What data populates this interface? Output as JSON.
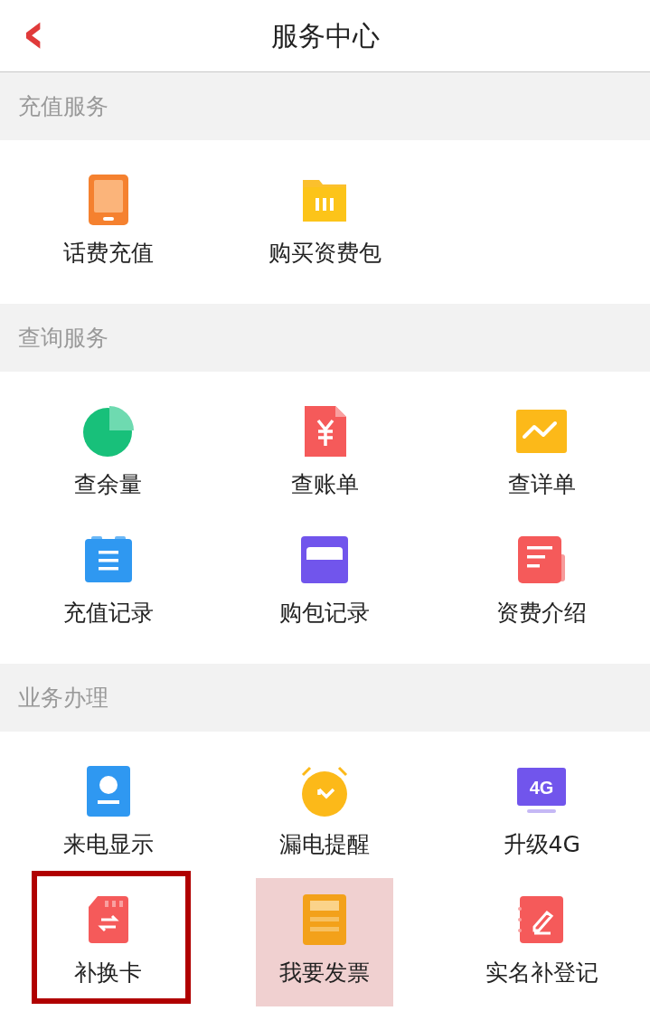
{
  "header": {
    "title": "服务中心",
    "back": "‹"
  },
  "sections": [
    {
      "title": "充值服务",
      "items": [
        {
          "label": "话费充值",
          "kind": "phone",
          "selected": false,
          "outlined": false
        },
        {
          "label": "购买资费包",
          "kind": "folder",
          "selected": false,
          "outlined": false
        }
      ]
    },
    {
      "title": "查询服务",
      "items": [
        {
          "label": "查余量",
          "kind": "pie",
          "selected": false,
          "outlined": false
        },
        {
          "label": "查账单",
          "kind": "yen",
          "selected": false,
          "outlined": false
        },
        {
          "label": "查详单",
          "kind": "trend",
          "selected": false,
          "outlined": false
        },
        {
          "label": "充值记录",
          "kind": "clipboard",
          "selected": false,
          "outlined": false
        },
        {
          "label": "购包记录",
          "kind": "card",
          "selected": false,
          "outlined": false
        },
        {
          "label": "资费介绍",
          "kind": "doc",
          "selected": false,
          "outlined": false
        }
      ]
    },
    {
      "title": "业务办理",
      "items": [
        {
          "label": "来电显示",
          "kind": "contact",
          "selected": false,
          "outlined": false
        },
        {
          "label": "漏电提醒",
          "kind": "alarm",
          "selected": false,
          "outlined": false
        },
        {
          "label": "升级4G",
          "kind": "screen",
          "badge": "4G",
          "selected": false,
          "outlined": false
        },
        {
          "label": "补换卡",
          "kind": "sim",
          "selected": false,
          "outlined": true
        },
        {
          "label": "我要发票",
          "kind": "invoice",
          "selected": true,
          "outlined": false
        },
        {
          "label": "实名补登记",
          "kind": "notebook",
          "selected": false,
          "outlined": false
        }
      ]
    }
  ]
}
